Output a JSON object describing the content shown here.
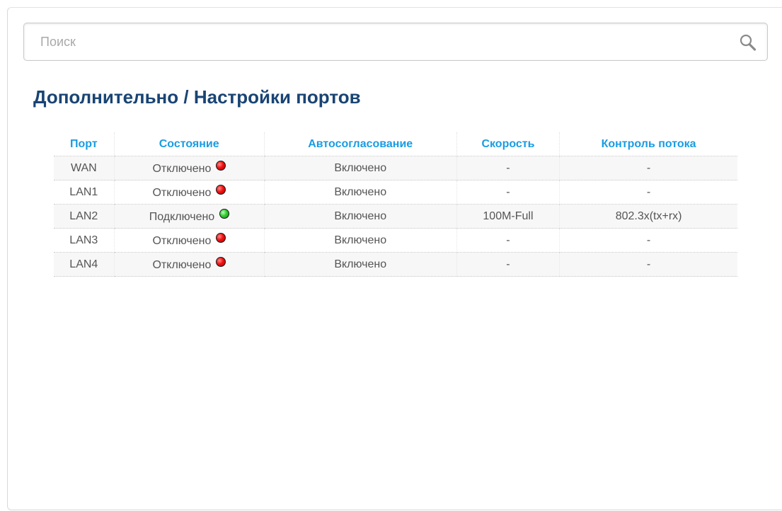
{
  "search": {
    "placeholder": "Поиск",
    "value": ""
  },
  "breadcrumb": {
    "parent": "Дополнительно",
    "separator": " / ",
    "current": "Настройки портов"
  },
  "table": {
    "columns": [
      "Порт",
      "Состояние",
      "Автосогласование",
      "Скорость",
      "Контроль потока"
    ],
    "rows": [
      {
        "port": "WAN",
        "state": "Отключено",
        "state_status": "disconnected",
        "auto": "Включено",
        "speed": "-",
        "flow": "-"
      },
      {
        "port": "LAN1",
        "state": "Отключено",
        "state_status": "disconnected",
        "auto": "Включено",
        "speed": "-",
        "flow": "-"
      },
      {
        "port": "LAN2",
        "state": "Подключено",
        "state_status": "connected",
        "auto": "Включено",
        "speed": "100M-Full",
        "flow": "802.3x(tx+rx)"
      },
      {
        "port": "LAN3",
        "state": "Отключено",
        "state_status": "disconnected",
        "auto": "Включено",
        "speed": "-",
        "flow": "-"
      },
      {
        "port": "LAN4",
        "state": "Отключено",
        "state_status": "disconnected",
        "auto": "Включено",
        "speed": "-",
        "flow": "-"
      }
    ]
  },
  "colors": {
    "title": "#194474",
    "header": "#1a9ce3",
    "cell_text": "#555555",
    "status_connected": "#33cc33",
    "status_disconnected": "#f01010"
  },
  "icons": {
    "search": "search-icon",
    "status_connected": "green-status-icon",
    "status_disconnected": "red-status-icon"
  }
}
